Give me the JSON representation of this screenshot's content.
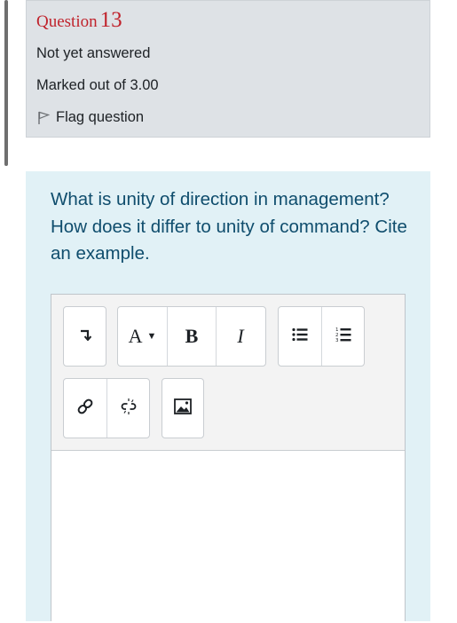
{
  "question_info": {
    "label": "Question",
    "number": "13",
    "state": "Not yet answered",
    "marks": "Marked out of 3.00",
    "flag_label": "Flag question"
  },
  "question": {
    "text": "What is unity of direction in management? How does it differ to unity of command? Cite an example."
  },
  "editor": {
    "toolbar": [
      {
        "icon": "show-more-icon",
        "glyph": "↴"
      },
      {
        "icon": "font-style-icon",
        "glyph": "A"
      },
      {
        "icon": "bold-icon",
        "glyph": "B"
      },
      {
        "icon": "italic-icon",
        "glyph": "I"
      },
      {
        "icon": "bullet-list-icon"
      },
      {
        "icon": "numbered-list-icon"
      },
      {
        "icon": "link-icon"
      },
      {
        "icon": "unlink-icon"
      },
      {
        "icon": "image-icon"
      }
    ],
    "content": ""
  },
  "colors": {
    "question_number": "#c0232c",
    "question_text": "#0f4d6d",
    "question_bg": "#e1f1f6",
    "info_bg": "#dee2e6"
  }
}
